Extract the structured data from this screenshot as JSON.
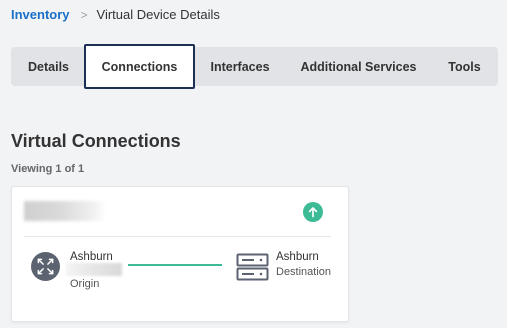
{
  "breadcrumb": {
    "root": "Inventory",
    "separator": ">",
    "current": "Virtual Device Details"
  },
  "tabs": [
    {
      "label": "Details",
      "active": false
    },
    {
      "label": "Connections",
      "active": true
    },
    {
      "label": "Interfaces",
      "active": false
    },
    {
      "label": "Additional Services",
      "active": false
    },
    {
      "label": "Tools",
      "active": false
    }
  ],
  "section": {
    "title": "Virtual Connections",
    "viewing": "Viewing 1 of 1"
  },
  "connection": {
    "status_icon": "arrow-up-icon",
    "status_color": "#3dba96",
    "origin": {
      "city": "Ashburn",
      "label": "Origin",
      "icon": "cross-connect-icon"
    },
    "destination": {
      "city": "Ashburn",
      "label": "Destination",
      "icon": "server-rack-icon"
    }
  },
  "colors": {
    "link": "#1a6fc9",
    "active_tab_border": "#1c2f55",
    "status_up": "#3dba96",
    "origin_icon_bg": "#5b6270"
  }
}
